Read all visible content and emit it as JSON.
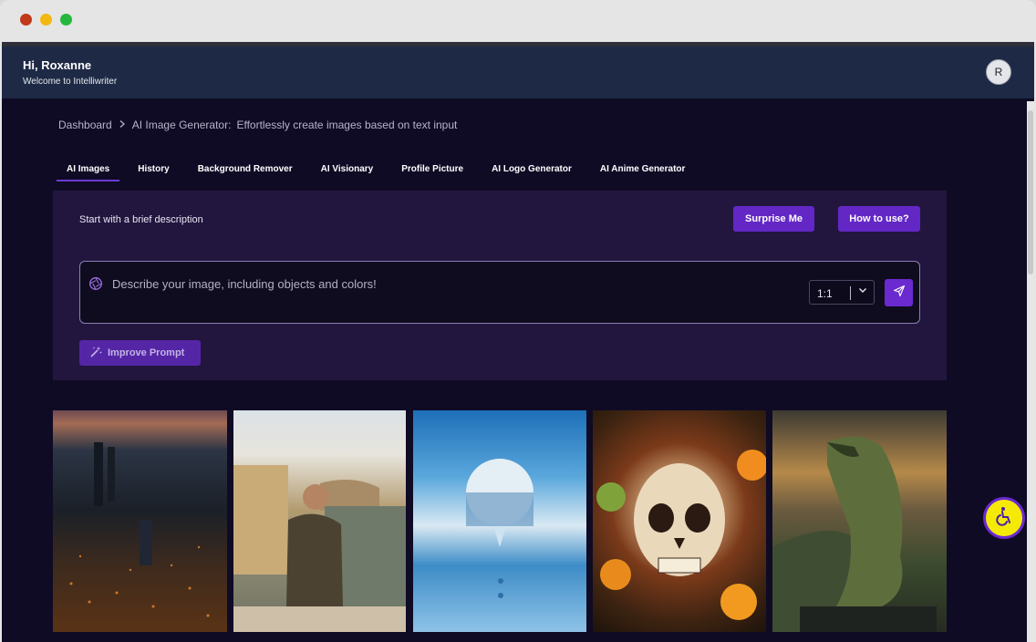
{
  "window": {
    "controls": [
      "close",
      "minimize",
      "zoom"
    ]
  },
  "header": {
    "greeting": "Hi, Roxanne",
    "subtitle": "Welcome to Intelliwriter",
    "avatar_initial": "R"
  },
  "breadcrumb": {
    "root": "Dashboard",
    "separator_icon": "chevron-right-icon",
    "current": "AI Image Generator:",
    "description": "Effortlessly create images based on text input"
  },
  "tabs": [
    {
      "label": "AI Images",
      "active": true
    },
    {
      "label": "History",
      "active": false
    },
    {
      "label": "Background Remover",
      "active": false
    },
    {
      "label": "AI Visionary",
      "active": false
    },
    {
      "label": "Profile Picture",
      "active": false
    },
    {
      "label": "AI Logo Generator",
      "active": false
    },
    {
      "label": "AI Anime Generator",
      "active": false
    }
  ],
  "panel": {
    "label": "Start with a brief description",
    "surprise_button": "Surprise Me",
    "howto_button": "How to use?",
    "prompt_placeholder": "Describe your image, including objects and colors!",
    "aspect_ratio": "1:1",
    "improve_button": "Improve Prompt"
  },
  "gallery": [
    {
      "subject": "aerial city at dusk"
    },
    {
      "subject": "man seated by river"
    },
    {
      "subject": "floating sphere above clouds"
    },
    {
      "subject": "decorated skull with fruit"
    },
    {
      "subject": "dragon on rock"
    }
  ],
  "colors": {
    "accent": "#6327c5",
    "background": "#0f0b25",
    "header": "#1e2a45",
    "panel": "#22163f",
    "accessibility": "#f5ea06"
  }
}
